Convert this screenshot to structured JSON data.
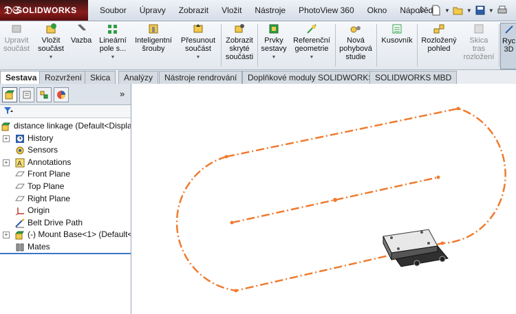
{
  "app": {
    "logo_mark": "𝔇𝔖",
    "logo_text": "SOLIDWORKS"
  },
  "menu": [
    "Soubor",
    "Úpravy",
    "Zobrazit",
    "Vložit",
    "Nástroje",
    "PhotoView 360",
    "Okno",
    "Nápověda"
  ],
  "ribbon": [
    {
      "label": "Upravit\nsoučást",
      "disabled": true,
      "icon": "edit-component-icon"
    },
    {
      "label": "Vložit\nsoučást",
      "disabled": false,
      "icon": "insert-component-icon"
    },
    {
      "label": "Vazba",
      "disabled": false,
      "icon": "mate-icon"
    },
    {
      "label": "Lineární\npole s...",
      "disabled": false,
      "icon": "linear-pattern-icon"
    },
    {
      "label": "Inteligentní\nšrouby",
      "disabled": false,
      "icon": "smart-fasteners-icon"
    },
    {
      "label": "Přesunout\nsoučást",
      "disabled": false,
      "icon": "move-component-icon"
    },
    {
      "label": "Zobrazit\nskryté\nsoučásti",
      "disabled": false,
      "icon": "show-hidden-icon"
    },
    {
      "label": "Prvky\nsestavy",
      "disabled": false,
      "icon": "assembly-features-icon"
    },
    {
      "label": "Referenční\ngeometrie",
      "disabled": false,
      "icon": "reference-geometry-icon"
    },
    {
      "label": "Nová\npohybová\nstudie",
      "disabled": false,
      "icon": "motion-study-icon"
    },
    {
      "label": "Kusovník",
      "disabled": false,
      "icon": "bom-icon"
    },
    {
      "label": "Rozložený\npohled",
      "disabled": false,
      "icon": "exploded-view-icon"
    },
    {
      "label": "Skica\ntras\nrozložení",
      "disabled": true,
      "icon": "explode-line-sketch-icon"
    },
    {
      "label": "Ryc\n3D",
      "disabled": false,
      "icon": "instant3d-icon"
    }
  ],
  "tabs": [
    "Sestava",
    "Rozvržení",
    "Skica",
    "Analýzy",
    "Nástroje rendrování",
    "Doplňkové moduly SOLIDWORKS",
    "SOLIDWORKS MBD"
  ],
  "active_tab": "Sestava",
  "panel": {
    "expand": "»"
  },
  "tree": [
    {
      "label": "distance linkage  (Default<Displa",
      "indent": 0,
      "exp": "",
      "icon": "assembly-icon"
    },
    {
      "label": "History",
      "indent": 1,
      "exp": "+",
      "icon": "history-icon"
    },
    {
      "label": "Sensors",
      "indent": 1,
      "exp": "",
      "icon": "sensors-icon"
    },
    {
      "label": "Annotations",
      "indent": 1,
      "exp": "+",
      "icon": "annotations-icon"
    },
    {
      "label": "Front Plane",
      "indent": 1,
      "exp": "",
      "icon": "plane-icon"
    },
    {
      "label": "Top Plane",
      "indent": 1,
      "exp": "",
      "icon": "plane-icon"
    },
    {
      "label": "Right Plane",
      "indent": 1,
      "exp": "",
      "icon": "plane-icon"
    },
    {
      "label": "Origin",
      "indent": 1,
      "exp": "",
      "icon": "origin-icon"
    },
    {
      "label": "Belt Drive Path",
      "indent": 1,
      "exp": "",
      "icon": "sketch-icon"
    },
    {
      "label": "(-) Mount Base<1> (Default<",
      "indent": 1,
      "exp": "+",
      "icon": "part-icon"
    },
    {
      "label": "Mates",
      "indent": 1,
      "exp": "",
      "icon": "mates-icon"
    }
  ],
  "colors": {
    "sketch": "#f07a2e",
    "selection": "#3a76c9"
  }
}
